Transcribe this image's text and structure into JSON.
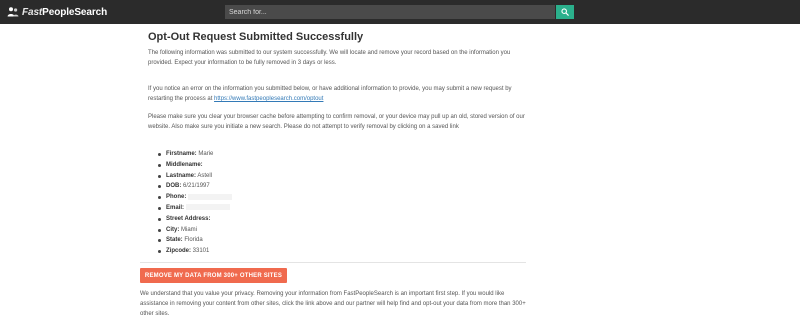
{
  "navbar": {
    "logo_prefix": "Fast",
    "logo_suffix": "PeopleSearch",
    "search_placeholder": "Search for...",
    "bg_color": "#2b2b2b",
    "search_button_color": "#2bb08c",
    "search_button_icon": "search-icon"
  },
  "main": {
    "title": "Opt-Out Request Submitted Successfully",
    "paragraph1": "The following information was submitted to our system successfully. We will locate and remove your record based on the information you provided. Expect your information to be fully removed in 3 days or less.",
    "paragraph2_prefix": "If you notice an error on the information you submitted below, or have additional information to provide, you may submit a new request by restarting the process at ",
    "paragraph2_link": "https://www.fastpeoplesearch.com/optout",
    "paragraph3": "Please make sure you clear your browser cache before attempting to confirm removal, or your device may pull up an old, stored version of our website. Also make sure you initiate a new search. Please do not attempt to verify removal by clicking on a saved link",
    "fields": [
      {
        "label": "Firstname:",
        "value": "Marie"
      },
      {
        "label": "Middlename:",
        "value": ""
      },
      {
        "label": "Lastname:",
        "value": "Astell"
      },
      {
        "label": "DOB:",
        "value": "6/21/1997"
      },
      {
        "label": "Phone:",
        "value": ""
      },
      {
        "label": "Email:",
        "value": ""
      },
      {
        "label": "Street Address:",
        "value": ""
      },
      {
        "label": "City:",
        "value": "Miami"
      },
      {
        "label": "State:",
        "value": "Florida"
      },
      {
        "label": "Zipcode:",
        "value": "33101"
      }
    ],
    "remove_button_label": "REMOVE MY DATA FROM 300+ OTHER SITES",
    "remove_button_color": "#f06a4e",
    "paragraph4": "We understand that you value your privacy. Removing your information from FastPeopleSearch is an important first step. If you would like assistance in removing your content from other sites, click the link above and our partner will help find and opt-out your data from more than 300+ other sites."
  }
}
